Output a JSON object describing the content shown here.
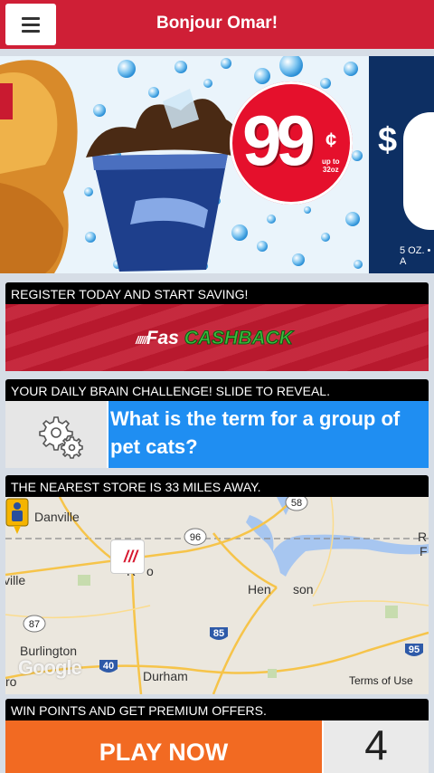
{
  "header": {
    "title": "Bonjour Omar!",
    "menu_icon": "hamburger-menu-icon"
  },
  "banner": {
    "price": "99",
    "cents_symbol": "¢",
    "size_note_line1": "up to",
    "size_note_line2": "32oz",
    "next_promo_dollar": "$",
    "next_promo_note": "5 OZ. • A"
  },
  "register": {
    "heading": "REGISTER TODAY AND START SAVING!",
    "logo_fas": "Fas",
    "logo_cashback": "CASHBACK",
    "logo_lines": "/////"
  },
  "brain": {
    "heading": "YOUR DAILY BRAIN CHALLENGE! SLIDE TO REVEAL.",
    "question": "What is the term for a group of pet cats?",
    "icon": "gears-icon"
  },
  "store": {
    "heading": "THE NEAREST STORE IS 33 MILES AWAY.",
    "map_labels": {
      "danville": "Danville",
      "ville": "ville",
      "roxboro": "R",
      "roxboro_end": "o",
      "henderson_start": "Hen",
      "henderson_end": "son",
      "burlington": "Burlington",
      "durham": "Durham",
      "ro": "ro",
      "r_right": "R",
      "f_right": "F"
    },
    "route_shields": {
      "r58": "58",
      "r96": "96",
      "r87": "87",
      "r85": "85",
      "r40": "40",
      "r95": "95"
    },
    "google_mark": "Google",
    "terms": "Terms of Use",
    "store_logo": "///"
  },
  "offers": {
    "heading": "WIN POINTS AND GET PREMIUM OFFERS.",
    "play_label": "PLAY NOW",
    "points": "4"
  }
}
